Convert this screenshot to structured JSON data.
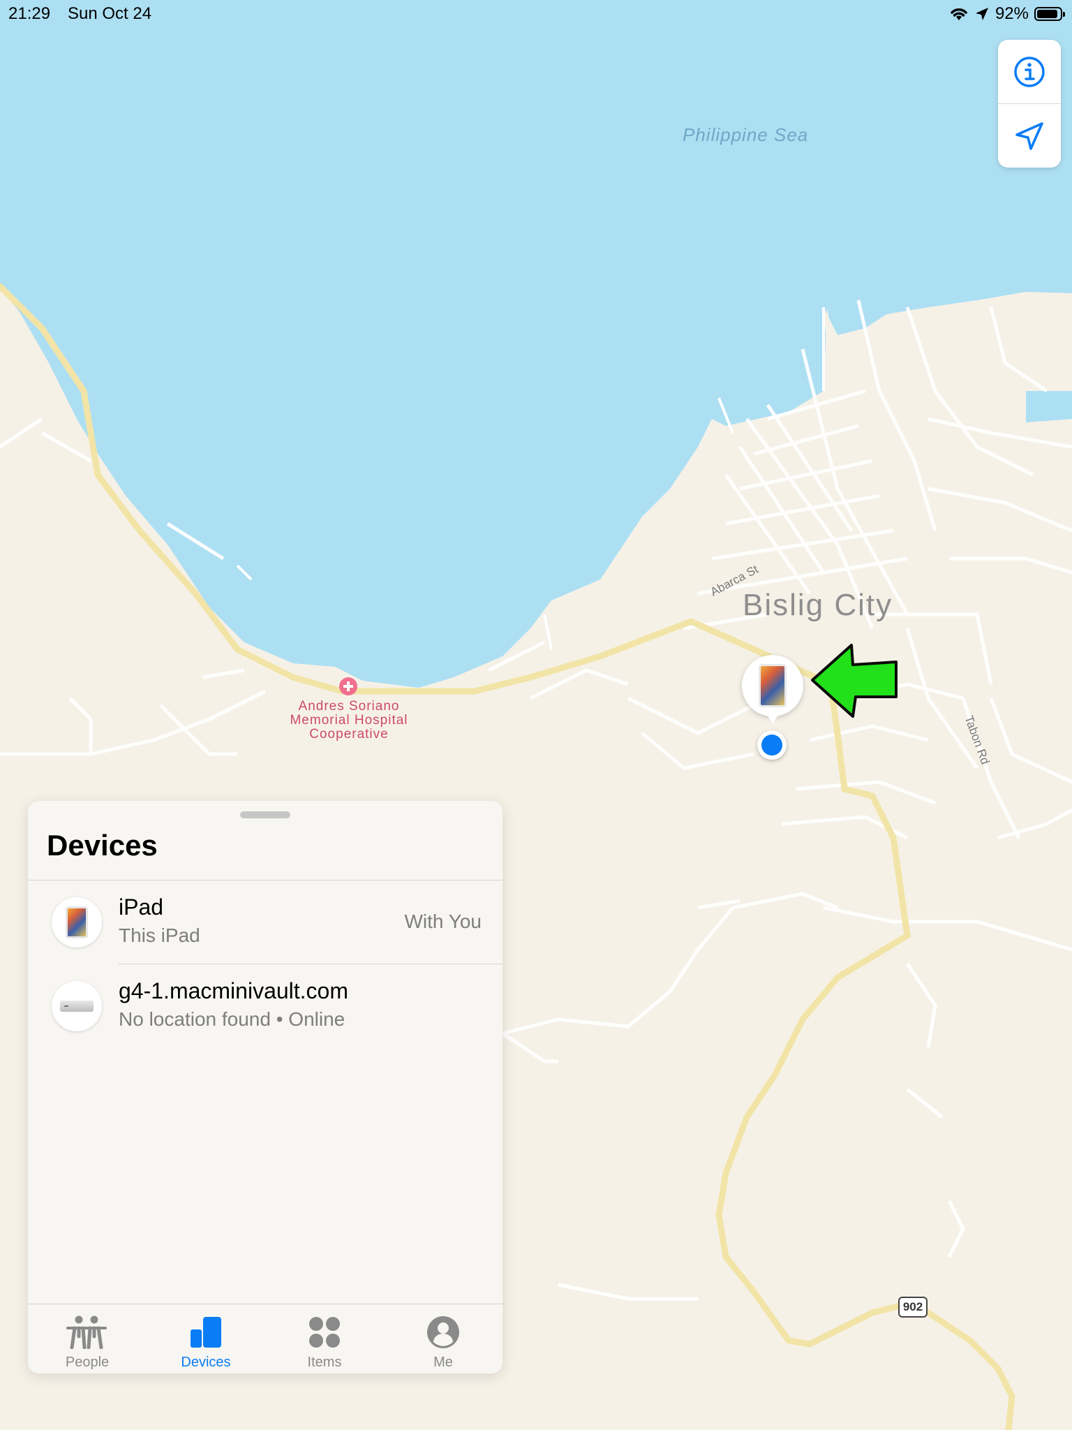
{
  "status_bar": {
    "time": "21:29",
    "date": "Sun Oct 24",
    "battery_percent": "92%",
    "battery_level": 0.92,
    "icons": [
      "wifi-icon",
      "location-arrow-icon",
      "battery-icon"
    ]
  },
  "map": {
    "sea_label": "Philippine Sea",
    "city_label": "Bislig City",
    "hospital_label": "Andres Soriano Memorial Hospital Cooperative",
    "road_labels": [
      "Abarca St",
      "Tabon Rd"
    ],
    "route_number": "902",
    "colors": {
      "water": "#addff3",
      "land": "#f6f1e7",
      "major_road": "#f7e7a8",
      "user_location": "#0a7cf5",
      "annotation_arrow": "#22e01a"
    }
  },
  "map_controls": {
    "info_icon": "info-icon",
    "location_icon": "location-arrow-icon"
  },
  "devices_sheet": {
    "title": "Devices",
    "devices": [
      {
        "name": "iPad",
        "subtitle": "This iPad",
        "status": "With You",
        "icon": "ipad-icon"
      },
      {
        "name": "g4-1.macminivault.com",
        "subtitle": "No location found • Online",
        "status": "",
        "icon": "mac-mini-icon"
      }
    ]
  },
  "tab_bar": {
    "tabs": [
      {
        "label": "People",
        "icon": "people-icon",
        "active": false
      },
      {
        "label": "Devices",
        "icon": "devices-icon",
        "active": true
      },
      {
        "label": "Items",
        "icon": "items-icon",
        "active": false
      },
      {
        "label": "Me",
        "icon": "me-icon",
        "active": false
      }
    ],
    "accent": "#0a7cf5",
    "inactive": "#8a8a8a"
  }
}
